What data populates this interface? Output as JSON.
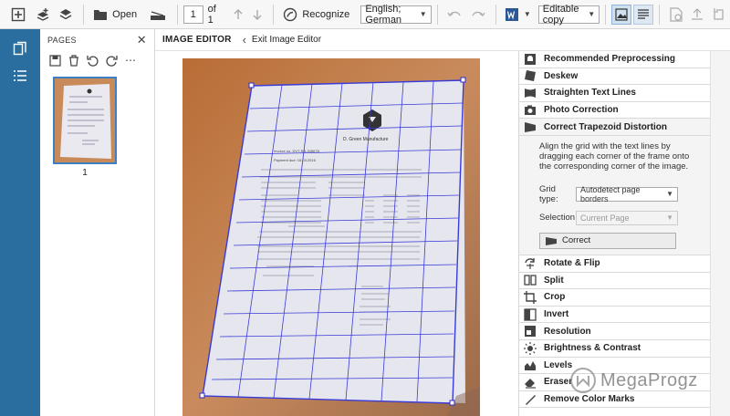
{
  "toolbar": {
    "open_label": "Open",
    "page_number": "1",
    "page_of": "of 1",
    "recognize_label": "Recognize",
    "language": "English; German",
    "output_mode": "Editable copy"
  },
  "pages": {
    "title": "PAGES",
    "thumb_number": "1"
  },
  "editor": {
    "title": "IMAGE EDITOR",
    "exit_label": "Exit Image Editor"
  },
  "tools": {
    "recommended": "Recommended Preprocessing",
    "deskew": "Deskew",
    "straighten": "Straighten Text Lines",
    "photo": "Photo Correction",
    "trapezoid": "Correct Trapezoid Distortion",
    "rotate": "Rotate & Flip",
    "split": "Split",
    "crop": "Crop",
    "invert": "Invert",
    "resolution": "Resolution",
    "brightness": "Brightness & Contrast",
    "levels": "Levels",
    "eraser": "Eraser",
    "remove_color": "Remove Color Marks"
  },
  "trapezoid_panel": {
    "description": "Align the grid with the text lines by dragging each corner of the frame onto the corresponding corner of the image.",
    "grid_label": "Grid type:",
    "grid_value": "Autodetect page borders",
    "selection_label": "Selection:",
    "selection_value": "Current Page",
    "correct_label": "Correct"
  },
  "document": {
    "company": "D. Green Manufacture",
    "invoice": "Invoice no. DVT-RA-345678",
    "payment": "Payment due: 15.03.2016"
  },
  "watermark": "MegaProgz"
}
